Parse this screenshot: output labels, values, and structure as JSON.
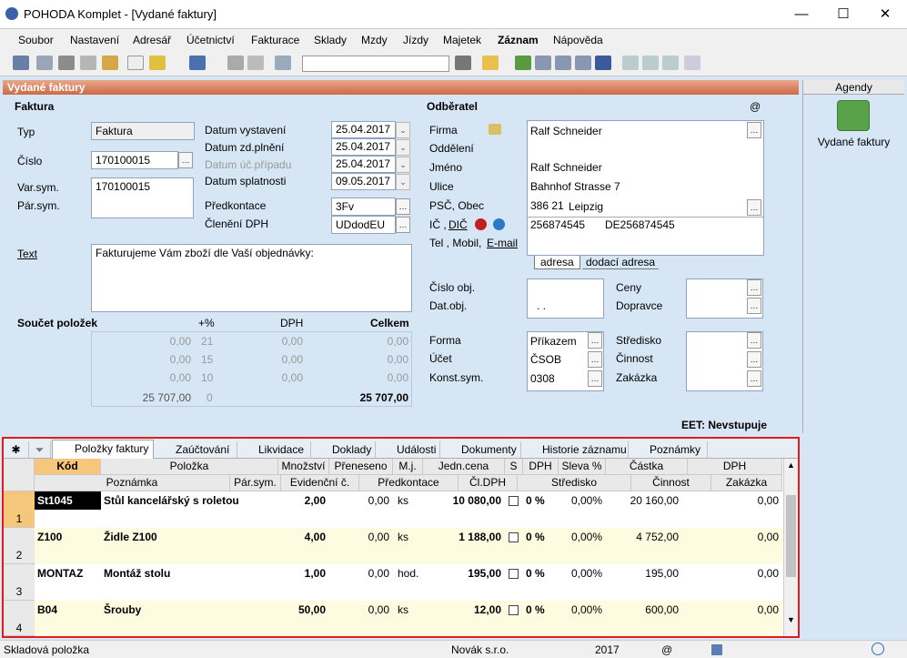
{
  "window": {
    "title": "POHODA Komplet - [Vydané faktury]"
  },
  "menu": [
    "Soubor",
    "Nastavení",
    "Adresář",
    "Účetnictví",
    "Fakturace",
    "Sklady",
    "Mzdy",
    "Jízdy",
    "Majetek",
    "Záznam",
    "Nápověda"
  ],
  "agenda_header": "Vydané faktury",
  "faktura": {
    "section": "Faktura",
    "typ_label": "Typ",
    "typ_value": "Faktura",
    "cislo_label": "Číslo",
    "cislo_value": "170100015",
    "varsym_label": "Var.sym.",
    "varsym_value": "170100015",
    "parsym_label": "Pár.sym.",
    "datum_vystaveni_label": "Datum vystavení",
    "datum_vystaveni": "25.04.2017",
    "datum_zdplneni_label": "Datum zd.plnění",
    "datum_zdplneni": "25.04.2017",
    "datum_ucpripadu_label": "Datum úč.případu",
    "datum_ucpripadu": "25.04.2017",
    "datum_splatnosti_label": "Datum splatnosti",
    "datum_splatnosti": "09.05.2017",
    "predkontace_label": "Předkontace",
    "predkontace": "3Fv",
    "cleneni_label": "Členění DPH",
    "cleneni": "UDdodEU",
    "text_label": "Text",
    "text_value": "Fakturujeme Vám zboží dle Vaší objednávky:"
  },
  "soucet": {
    "label": "Součet položek",
    "h_pct": "+%",
    "h_dph": "DPH",
    "h_celkem": "Celkem",
    "rows": [
      {
        "base": "0,00",
        "pct": "21",
        "dph": "0,00",
        "celkem": "0,00"
      },
      {
        "base": "0,00",
        "pct": "15",
        "dph": "0,00",
        "celkem": "0,00"
      },
      {
        "base": "0,00",
        "pct": "10",
        "dph": "0,00",
        "celkem": "0,00"
      },
      {
        "base": "25 707,00",
        "pct": "0",
        "dph": "",
        "celkem": "25 707,00"
      }
    ]
  },
  "odberatel": {
    "section": "Odběratel",
    "at": "@",
    "firma_label": "Firma",
    "firma": "Ralf Schneider",
    "oddeleni_label": "Oddělení",
    "jmeno_label": "Jméno",
    "jmeno": "Ralf Schneider",
    "ulice_label": "Ulice",
    "ulice": "Bahnhof Strasse 7",
    "psc_label": "PSČ, Obec",
    "psc": "386 21",
    "obec": "Leipzig",
    "ic_label": "IČ ,",
    "dic_label": "DIČ",
    "ic": "256874545",
    "dic": "DE256874545",
    "tel_label": "Tel , Mobil,",
    "email_label": "E-mail",
    "tab_adresa": "adresa",
    "tab_dodaci": "dodací adresa",
    "cislo_obj_label": "Číslo obj.",
    "dat_obj_label": "Dat.obj.",
    "dat_obj_value": ". .",
    "ceny_label": "Ceny",
    "dopravce_label": "Dopravce",
    "forma_label": "Forma",
    "forma": "Příkazem",
    "ucet_label": "Účet",
    "ucet": "ČSOB",
    "konst_label": "Konst.sym.",
    "konst": "0308",
    "stredisko_label": "Středisko",
    "cinnost_label": "Činnost",
    "zakazka_label": "Zakázka",
    "eet": "EET: Nevstupuje"
  },
  "agendy": {
    "header": "Agendy",
    "item": "Vydané faktury"
  },
  "tabs": [
    "Položky faktury",
    "Zaúčtování",
    "Likvidace",
    "Doklady",
    "Události",
    "Dokumenty",
    "Historie záznamu",
    "Poznámky"
  ],
  "grid": {
    "h1": [
      "Kód",
      "Položka",
      "Množství",
      "Přeneseno",
      "M.j.",
      "Jedn.cena",
      "S",
      "DPH",
      "Sleva %",
      "Částka",
      "DPH"
    ],
    "h2": [
      "Poznámka",
      "Pár.sym.",
      "Evidenční č.",
      "Předkontace",
      "Čl.DPH",
      "Středisko",
      "Činnost",
      "Zakázka"
    ],
    "rows": [
      {
        "n": "1",
        "kod": "St1045",
        "polozka": "Stůl kancelářský s roletou",
        "mnozstvi": "2,00",
        "preneseno": "0,00",
        "mj": "ks",
        "cena": "10 080,00",
        "dph": "0 %",
        "sleva": "0,00%",
        "castka": "20 160,00",
        "dphc": "0,00"
      },
      {
        "n": "2",
        "kod": "Z100",
        "polozka": "Židle Z100",
        "mnozstvi": "4,00",
        "preneseno": "0,00",
        "mj": "ks",
        "cena": "1 188,00",
        "dph": "0 %",
        "sleva": "0,00%",
        "castka": "4 752,00",
        "dphc": "0,00"
      },
      {
        "n": "3",
        "kod": "MONTAZ",
        "polozka": "Montáž stolu",
        "mnozstvi": "1,00",
        "preneseno": "0,00",
        "mj": "hod.",
        "cena": "195,00",
        "dph": "0 %",
        "sleva": "0,00%",
        "castka": "195,00",
        "dphc": "0,00"
      },
      {
        "n": "4",
        "kod": "B04",
        "polozka": "Šrouby",
        "mnozstvi": "50,00",
        "preneseno": "0,00",
        "mj": "ks",
        "cena": "12,00",
        "dph": "0 %",
        "sleva": "0,00%",
        "castka": "600,00",
        "dphc": "0,00"
      }
    ]
  },
  "status": {
    "left": "Skladová položka",
    "company": "Novák s.r.o.",
    "year": "2017",
    "at": "@"
  }
}
